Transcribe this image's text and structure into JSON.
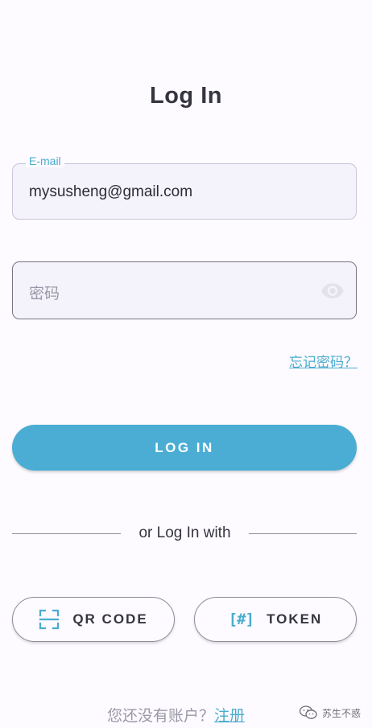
{
  "screen": {
    "title": "Log In"
  },
  "email": {
    "label": "E-mail",
    "value": "mysusheng@gmail.com"
  },
  "password": {
    "placeholder": "密码",
    "icon": "eye-icon"
  },
  "links": {
    "forgot_password": "忘记密码？"
  },
  "login_button": {
    "label": "LOG IN"
  },
  "divider": {
    "text": "or Log In with"
  },
  "alternatives": {
    "qr_label": "QR CODE",
    "qr_icon": "qr-scan-icon",
    "token_label": "TOKEN",
    "token_icon_text": "[#]"
  },
  "footer": {
    "prompt": "您还没有账户？",
    "register": "注册"
  },
  "watermark": {
    "text": "苏生不惑"
  },
  "colors": {
    "accent": "#4aaccf",
    "button": "#4badd4",
    "background": "#fdfbff",
    "field_fill": "#f4f2fb",
    "text": "#35353f"
  }
}
